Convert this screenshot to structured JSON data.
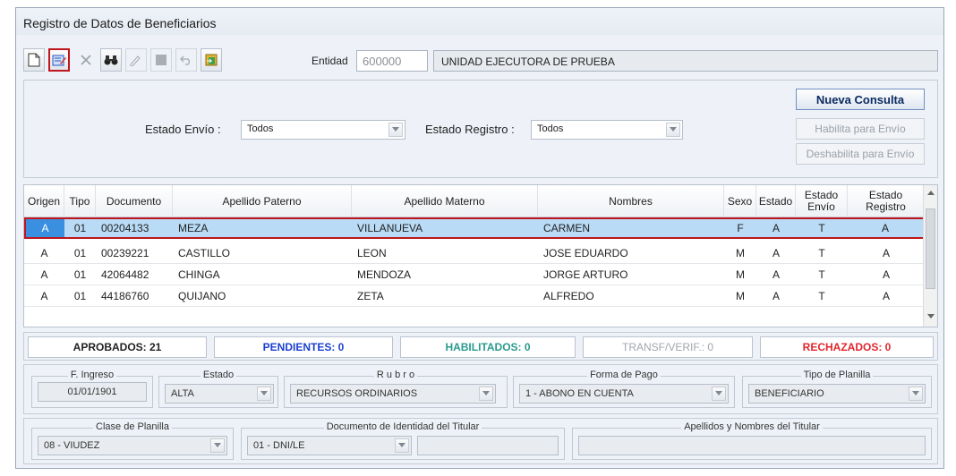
{
  "window": {
    "title": "Registro de Datos de Beneficiarios"
  },
  "toolbar": {
    "buttons": [
      {
        "icon": "new-document-icon"
      },
      {
        "icon": "edit-form-icon",
        "selected": true
      },
      {
        "icon": "delete-x-icon"
      },
      {
        "icon": "binoculars-icon"
      },
      {
        "icon": "pencil-edit-icon"
      },
      {
        "icon": "stop-square-icon"
      },
      {
        "icon": "undo-icon"
      },
      {
        "icon": "export-icon"
      }
    ],
    "entidad_label": "Entidad",
    "entidad_code": "600000",
    "entidad_name": "UNIDAD EJECUTORA DE PRUEBA"
  },
  "filters": {
    "estado_envio_label": "Estado Envío :",
    "estado_envio_value": "Todos",
    "estado_registro_label": "Estado Registro :",
    "estado_registro_value": "Todos",
    "nueva_consulta": "Nueva Consulta",
    "habilita": "Habilita para Envío",
    "deshabilita": "Deshabilita para Envío"
  },
  "grid": {
    "headers": [
      "Origen",
      "Tipo",
      "Documento",
      "Apellido Paterno",
      "Apellido Materno",
      "Nombres",
      "Sexo",
      "Estado",
      "Estado Envío",
      "Estado Registro"
    ],
    "rows": [
      [
        "A",
        "01",
        "00204133",
        "MEZA",
        "VILLANUEVA",
        "CARMEN",
        "F",
        "A",
        "T",
        "A"
      ],
      [
        "A",
        "01",
        "00239221",
        "CASTILLO",
        "LEON",
        "JOSE EDUARDO",
        "M",
        "A",
        "T",
        "A"
      ],
      [
        "A",
        "01",
        "42064482",
        "CHINGA",
        "MENDOZA",
        "JORGE ARTURO",
        "M",
        "A",
        "T",
        "A"
      ],
      [
        "A",
        "01",
        "44186760",
        "QUIJANO",
        "ZETA",
        "ALFREDO",
        "M",
        "A",
        "T",
        "A"
      ]
    ]
  },
  "status": {
    "aprobados": "APROBADOS: 21",
    "pendientes": "PENDIENTES: 0",
    "habilitados": "HABILITADOS: 0",
    "transf": "TRANSF/VERIF.: 0",
    "rechazados": "RECHAZADOS: 0",
    "colors": {
      "aprobados": "#1a1a1a",
      "pendientes": "#1a3fd0",
      "habilitados": "#2a9a8e",
      "transf": "#a0a6ad",
      "rechazados": "#e0262d"
    }
  },
  "details": {
    "f_ingreso_label": "F. Ingreso",
    "f_ingreso": "01/01/1901",
    "estado_label": "Estado",
    "estado": "ALTA",
    "rubro_label": "R u b r o",
    "rubro": "RECURSOS ORDINARIOS",
    "forma_pago_label": "Forma de Pago",
    "forma_pago": "1 - ABONO EN CUENTA",
    "tipo_planilla_label": "Tipo de Planilla",
    "tipo_planilla": "BENEFICIARIO",
    "clase_planilla_label": "Clase de Planilla",
    "clase_planilla": "08 - VIUDEZ",
    "doc_titular_label": "Documento de Identidad del Titular",
    "doc_titular_tipo": "01 - DNI/LE",
    "doc_titular_num": "",
    "nombres_titular_label": "Apellidos y Nombres del Titular",
    "nombres_titular": ""
  }
}
